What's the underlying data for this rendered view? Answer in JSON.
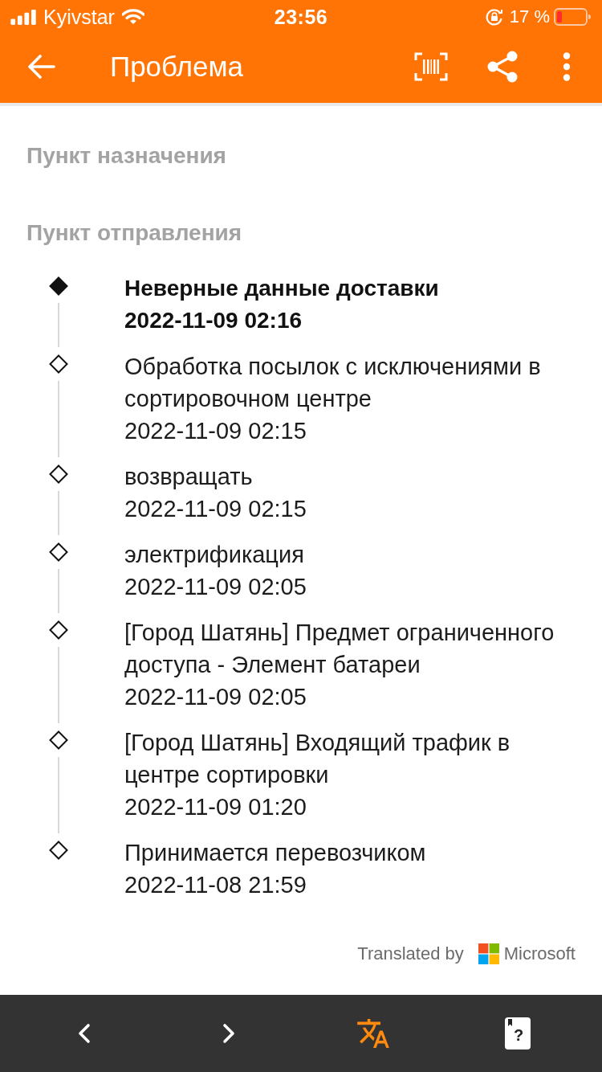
{
  "status_bar": {
    "carrier": "Kyivstar",
    "time": "23:56",
    "battery": "17 %"
  },
  "header": {
    "title": "Проблема"
  },
  "sections": [
    {
      "label": "Пункт назначения"
    },
    {
      "label": "Пункт отправления"
    }
  ],
  "events": [
    {
      "title": "Неверные данные доставки",
      "time": "2022-11-09 02:16",
      "current": true
    },
    {
      "title": "Обработка посылок с исключениями в сортировочном центре",
      "time": "2022-11-09 02:15",
      "current": false
    },
    {
      "title": "возвращать",
      "time": "2022-11-09 02:15",
      "current": false
    },
    {
      "title": "электрификация",
      "time": "2022-11-09 02:05",
      "current": false
    },
    {
      "title": "[Город Шатянь] Предмет ограниченного доступа - Элемент батареи",
      "time": "2022-11-09 02:05",
      "current": false
    },
    {
      "title": "[Город Шатянь] Входящий трафик в центре сортировки",
      "time": "2022-11-09 01:20",
      "current": false
    },
    {
      "title": "Принимается перевозчиком",
      "time": "2022-11-08 21:59",
      "current": false
    }
  ],
  "attribution": {
    "text": "Translated by",
    "brand": "Microsoft"
  },
  "bottom_bar": {
    "translate_on": true,
    "help_mark": "?"
  }
}
